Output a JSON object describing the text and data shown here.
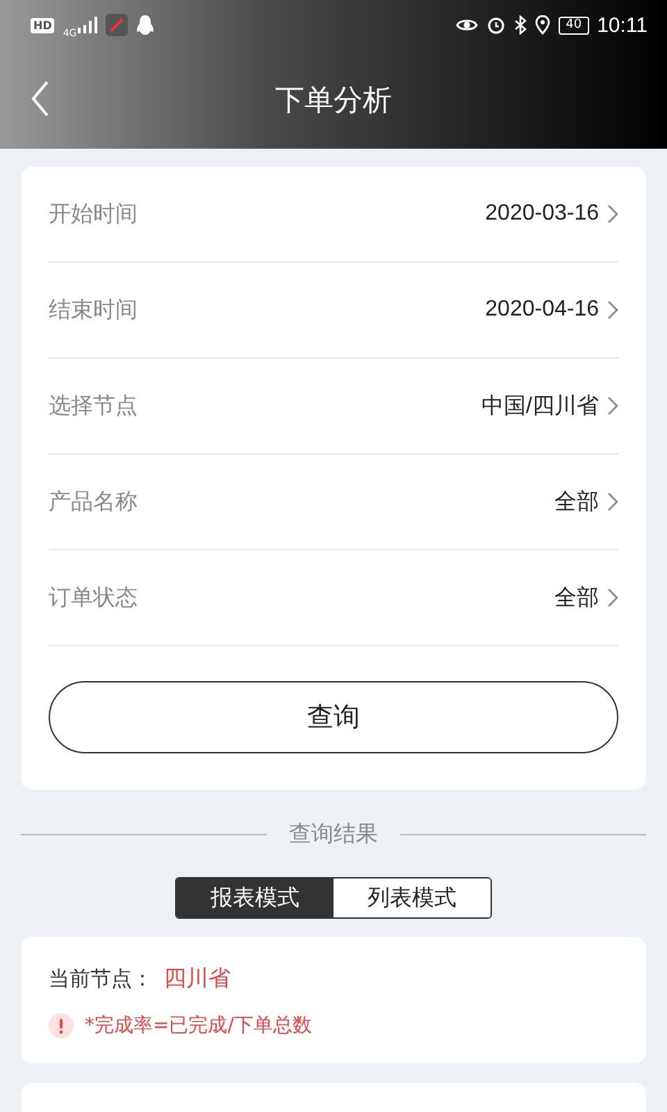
{
  "status_bar": {
    "hd": "HD",
    "network": "4G",
    "battery": "40",
    "time": "10:11"
  },
  "header": {
    "title": "下单分析"
  },
  "filters": [
    {
      "label": "开始时间",
      "value": "2020-03-16"
    },
    {
      "label": "结束时间",
      "value": "2020-04-16"
    },
    {
      "label": "选择节点",
      "value": "中国/四川省"
    },
    {
      "label": "产品名称",
      "value": "全部"
    },
    {
      "label": "订单状态",
      "value": "全部"
    }
  ],
  "query_button": "查询",
  "results_heading": "查询结果",
  "modes": [
    {
      "label": "报表模式",
      "selected": true
    },
    {
      "label": "列表模式",
      "selected": false
    }
  ],
  "info": {
    "node_label": "当前节点：",
    "node_value": "四川省",
    "note": "*完成率=已完成/下单总数"
  }
}
